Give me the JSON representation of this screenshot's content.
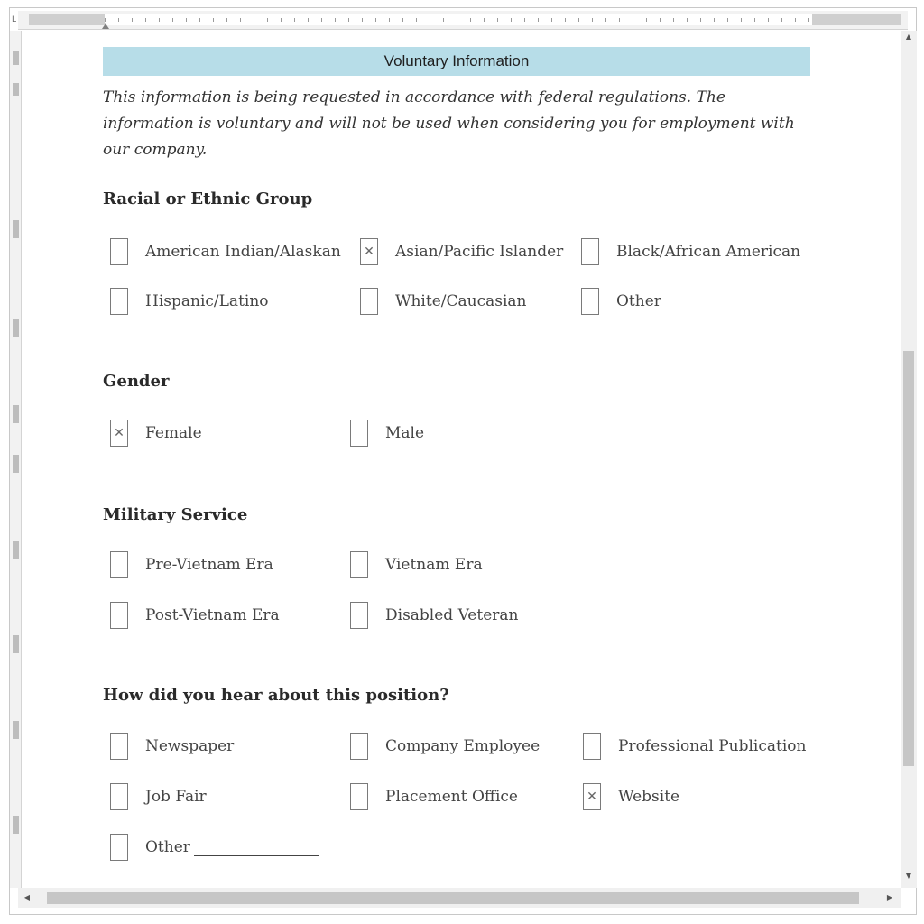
{
  "ruler": {
    "corner_glyph": "L"
  },
  "scrollbar": {
    "up_arrow": "▲",
    "down_arrow": "▼",
    "left_arrow": "◀",
    "right_arrow": "▶"
  },
  "banner": {
    "title": "Voluntary Information"
  },
  "intro": {
    "text": "This information is being requested in accordance with federal regulations. The information is voluntary and will not be used when considering you for employment with our company."
  },
  "checkbox": {
    "checked_mark": "✕"
  },
  "sections": {
    "racial": {
      "title": "Racial or Ethnic Group",
      "options": [
        {
          "label": "American Indian/Alaskan",
          "checked": false
        },
        {
          "label": "Asian/Pacific Islander",
          "checked": true
        },
        {
          "label": "Black/African American",
          "checked": false
        },
        {
          "label": "Hispanic/Latino",
          "checked": false
        },
        {
          "label": "White/Caucasian",
          "checked": false
        },
        {
          "label": "Other",
          "checked": false
        }
      ]
    },
    "gender": {
      "title": "Gender",
      "options": [
        {
          "label": "Female",
          "checked": true
        },
        {
          "label": "Male",
          "checked": false
        }
      ]
    },
    "military": {
      "title": "Military Service",
      "options": [
        {
          "label": "Pre-Vietnam Era",
          "checked": false
        },
        {
          "label": "Vietnam Era",
          "checked": false
        },
        {
          "label": "Post-Vietnam Era",
          "checked": false
        },
        {
          "label": "Disabled Veteran",
          "checked": false
        }
      ]
    },
    "source": {
      "title": "How did you hear about this position?",
      "options": [
        {
          "label": "Newspaper",
          "checked": false
        },
        {
          "label": "Company Employee",
          "checked": false
        },
        {
          "label": "Professional Publication",
          "checked": false
        },
        {
          "label": "Job Fair",
          "checked": false
        },
        {
          "label": "Placement Office",
          "checked": false
        },
        {
          "label": "Website",
          "checked": true
        },
        {
          "label": "Other",
          "checked": false
        }
      ]
    }
  }
}
